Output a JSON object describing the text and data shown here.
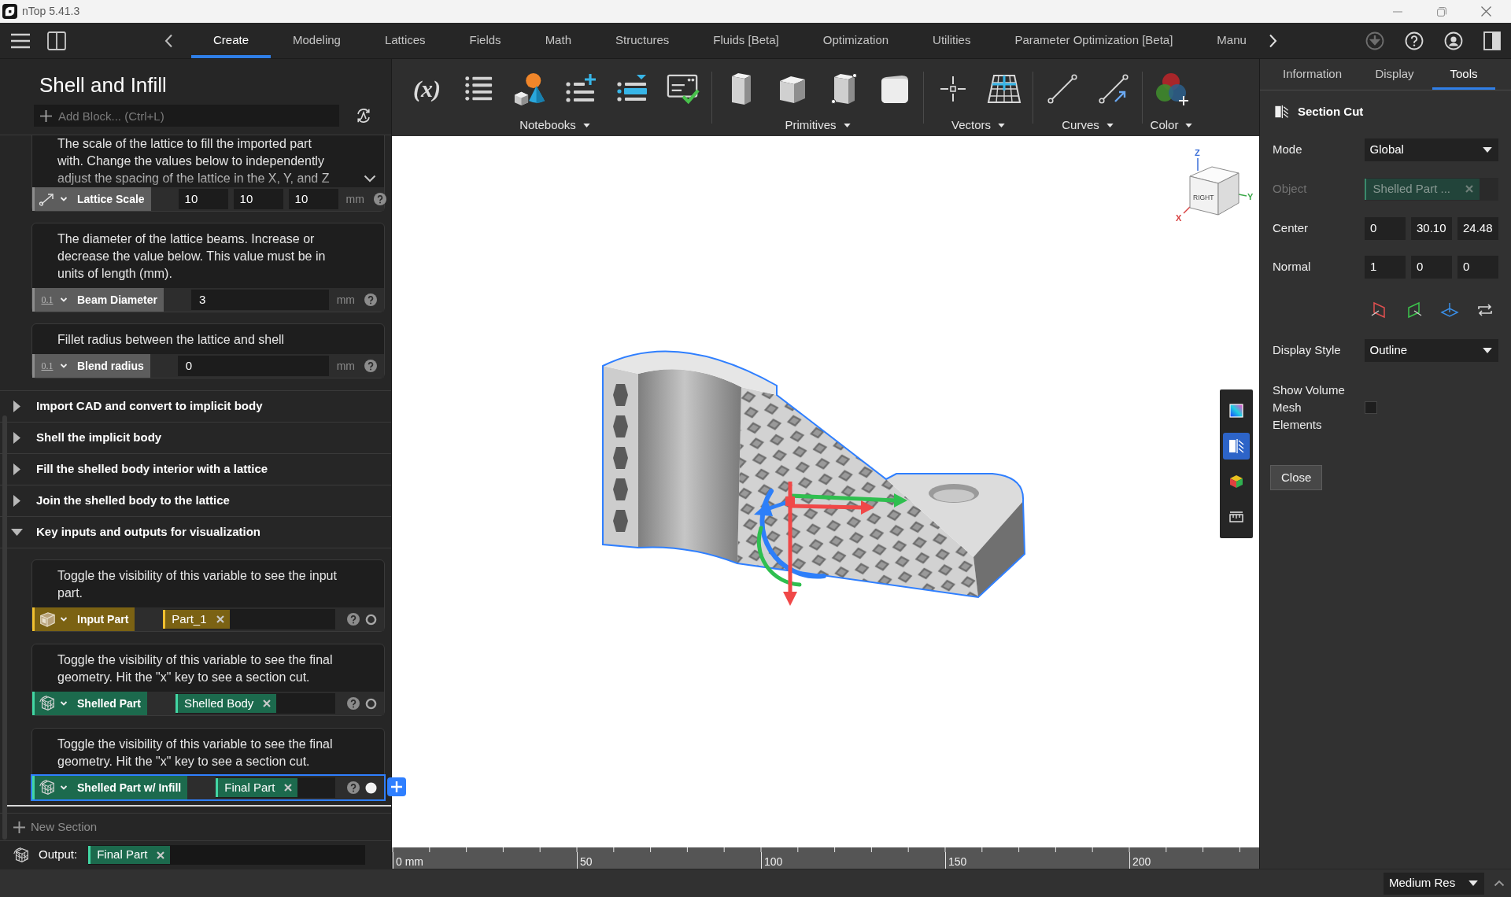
{
  "window": {
    "title": "nTop 5.41.3"
  },
  "menu_bar": {
    "tabs": [
      {
        "label": "Create",
        "selected": true
      },
      {
        "label": "Modeling",
        "selected": false
      },
      {
        "label": "Lattices",
        "selected": false
      },
      {
        "label": "Fields",
        "selected": false
      },
      {
        "label": "Math",
        "selected": false
      },
      {
        "label": "Structures",
        "selected": false
      },
      {
        "label": "Fluids [Beta]",
        "selected": false
      },
      {
        "label": "Optimization",
        "selected": false
      },
      {
        "label": "Utilities",
        "selected": false
      },
      {
        "label": "Parameter Optimization [Beta]",
        "selected": false
      },
      {
        "label": "Manu",
        "selected": false
      }
    ]
  },
  "toolbar": {
    "variable_glyph": "(x)",
    "groups": [
      {
        "label": "Notebooks"
      },
      {
        "label": "Primitives"
      },
      {
        "label": "Vectors"
      },
      {
        "label": "Curves"
      },
      {
        "label": "Color"
      }
    ]
  },
  "notebook": {
    "title": "Shell and Infill",
    "add_block": {
      "placeholder": "Add Block... (Ctrl+L)"
    },
    "blocks": [
      {
        "kind": "vector",
        "description": "The scale of the lattice to fill the imported part with. Change the values below to independently adjust the spacing of the lattice in the X, Y, and Z",
        "collapsed": true,
        "label": "Lattice Scale",
        "values": [
          "10",
          "10",
          "10"
        ],
        "unit": "mm"
      },
      {
        "kind": "scalar",
        "description": "The diameter of the lattice beams. Increase or decrease the value below. This value must be in units of length (mm).",
        "collapsed": false,
        "type_glyph": "0.1",
        "label": "Beam Diameter",
        "values": [
          "3"
        ],
        "unit": "mm"
      },
      {
        "kind": "scalar",
        "description": "Fillet radius between the lattice and shell",
        "collapsed": false,
        "type_glyph": "0.1",
        "label": "Blend radius",
        "values": [
          "0"
        ],
        "unit": "mm"
      }
    ],
    "sections": [
      {
        "title": "Import CAD and convert to implicit body",
        "expanded": false
      },
      {
        "title": "Shell the implicit body",
        "expanded": false
      },
      {
        "title": "Fill the shelled body interior with a lattice",
        "expanded": false
      },
      {
        "title": "Join the shelled body to the lattice",
        "expanded": false
      },
      {
        "title": "Key inputs and outputs for visualization",
        "expanded": true,
        "blocks": [
          {
            "kind": "part",
            "description": "Toggle the visibility of this variable to see the input part.",
            "label": "Input Part",
            "value": "Part_1",
            "visible": false,
            "selected": false
          },
          {
            "kind": "implicit",
            "description": "Toggle the visibility of this variable to see the final geometry. Hit the \"x\" key to see a section cut.",
            "label": "Shelled Part",
            "value": "Shelled Body",
            "visible": false,
            "selected": false
          },
          {
            "kind": "implicit",
            "description": "Toggle the visibility of this variable to see the final geometry. Hit the \"x\" key to see a section cut.",
            "label": "Shelled Part w/ Infill",
            "value": "Final Part",
            "visible": true,
            "selected": true
          }
        ]
      }
    ],
    "new_section": "New Section",
    "output": {
      "label": "Output:",
      "value": "Final Part"
    }
  },
  "viewport": {
    "view_cube": {
      "face": "RIGHT",
      "axes": {
        "z": "Z",
        "y": "Y",
        "x": "X"
      }
    },
    "side_tools": [
      {
        "selected": false
      },
      {
        "selected": true
      },
      {
        "selected": false
      },
      {
        "selected": false
      }
    ],
    "ruler": {
      "labels": [
        "0 mm",
        "50",
        "100",
        "150",
        "200"
      ]
    }
  },
  "properties": {
    "tabs": [
      {
        "label": "Information",
        "selected": false
      },
      {
        "label": "Display",
        "selected": false
      },
      {
        "label": "Tools",
        "selected": true
      }
    ],
    "tool_title": "Section Cut",
    "mode": {
      "label": "Mode",
      "value": "Global"
    },
    "object": {
      "label": "Object",
      "value": "Shelled Part ...",
      "disabled": true
    },
    "center": {
      "label": "Center",
      "values": [
        "0",
        "30.10",
        "24.48"
      ]
    },
    "normal": {
      "label": "Normal",
      "values": [
        "1",
        "0",
        "0"
      ]
    },
    "display_style": {
      "label": "Display Style",
      "value": "Outline"
    },
    "show_volume_mesh": {
      "label": "Show Volume Mesh Elements",
      "checked": false
    },
    "close_button": "Close"
  },
  "status_bar": {
    "resolution": "Medium Res"
  }
}
